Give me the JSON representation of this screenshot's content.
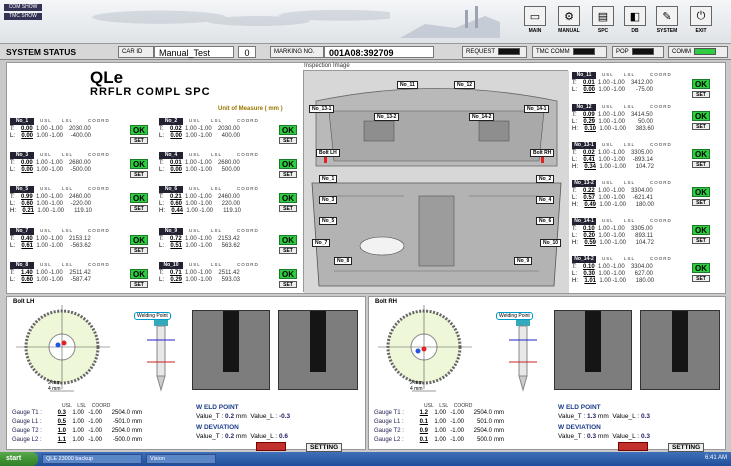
{
  "header": {
    "tag1": "COM SHOW",
    "tag2": "TMC SHOW",
    "nav": [
      {
        "label": "MAIN",
        "icon": "monitor-icon"
      },
      {
        "label": "MANUAL",
        "icon": "gears-icon"
      },
      {
        "label": "SPC",
        "icon": "chart-icon"
      },
      {
        "label": "DB",
        "icon": "database-icon"
      },
      {
        "label": "SYSTEM",
        "icon": "wrench-icon"
      },
      {
        "label": "EXIT",
        "icon": "power-icon"
      }
    ]
  },
  "status": {
    "title": "SYSTEM STATUS",
    "car_id_label": "CAR ID",
    "car_id": "Manual_Test",
    "count": "0",
    "marking_label": "MARKING NO.",
    "marking": "001A08:392709",
    "request": "REQUEST",
    "tmc": "TMC COMM",
    "pop": "POP",
    "comm": "COMM"
  },
  "main": {
    "title": "QLe",
    "subtitle": "RRFLR COMPL SPC",
    "unit": "Unit of Measure ( mm )",
    "image_title": "Inspection Image"
  },
  "cards": [
    {
      "name": "No_1",
      "t": "0.00",
      "l": "0.00",
      "ct": "2030.00",
      "cl": "-400.00",
      "ok": "OK",
      "set": "SET"
    },
    {
      "name": "No_2",
      "t": "0.02",
      "l": "0.00",
      "ct": "2030.00",
      "cl": "400.00",
      "ok": "OK",
      "set": "SET"
    },
    {
      "name": "No_3",
      "t": "0.00",
      "l": "0.00",
      "ct": "2680.00",
      "cl": "-500.00",
      "ok": "OK",
      "set": "SET"
    },
    {
      "name": "No_4",
      "t": "0.01",
      "l": "0.00",
      "ct": "2680.00",
      "cl": "500.00",
      "ok": "OK",
      "set": "SET"
    },
    {
      "name": "No_5",
      "t": "0.99",
      "l": "0.60",
      "h": "0.21",
      "ct": "2460.00",
      "cl": "-220.00",
      "ch": "119.10",
      "ok": "OK",
      "set": "SET"
    },
    {
      "name": "No_6",
      "t": "0.21",
      "l": "0.60",
      "h": "0.44",
      "ct": "2460.00",
      "cl": "220.00",
      "ch": "119.10",
      "ok": "OK",
      "set": "SET"
    },
    {
      "name": "No_7",
      "t": "0.40",
      "l": "0.61",
      "ct": "2153.12",
      "cl": "-563.62",
      "ok": "OK",
      "set": "SET"
    },
    {
      "name": "No_9",
      "t": "0.72",
      "l": "0.51",
      "ct": "2153.42",
      "cl": "563.62",
      "ok": "OK",
      "set": "SET"
    },
    {
      "name": "No_8",
      "t": "1.40",
      "l": "0.60",
      "ct": "2511.42",
      "cl": "-587.47",
      "ok": "OK",
      "set": "SET"
    },
    {
      "name": "No_10",
      "t": "0.71",
      "l": "0.29",
      "ct": "2511.42",
      "cl": "593.03",
      "ok": "OK",
      "set": "SET"
    },
    {
      "name": "No_11",
      "t": "0.01",
      "l": "0.00",
      "ct": "3412.00",
      "cl": "-75.00",
      "ok": "OK",
      "set": "SET"
    },
    {
      "name": "No_12",
      "t": "0.09",
      "l": "0.29",
      "h": "0.10",
      "ct": "3414.50",
      "cl": "50.00",
      "ch": "383.60",
      "ok": "OK",
      "set": "SET"
    },
    {
      "name": "No_13-1",
      "t": "0.02",
      "l": "0.41",
      "h": "0.34",
      "ct": "3305.00",
      "cl": "-893.14",
      "ch": "104.72",
      "ok": "OK",
      "set": "SET"
    },
    {
      "name": "No_13-2",
      "t": "0.22",
      "l": "0.57",
      "h": "0.49",
      "ct": "3304.00",
      "cl": "-621.41",
      "ch": "180.00",
      "ok": "OK",
      "set": "SET"
    },
    {
      "name": "No_14-1",
      "t": "0.10",
      "l": "0.20",
      "h": "0.59",
      "ct": "3305.00",
      "cl": "893.11",
      "ch": "104.72",
      "ok": "OK",
      "set": "SET"
    },
    {
      "name": "No_14-2",
      "t": "0.10",
      "l": "0.30",
      "h": "1.01",
      "ct": "3304.00",
      "cl": "627.00",
      "ch": "180.00",
      "ok": "OK",
      "set": "SET"
    }
  ],
  "card_headers": {
    "usl": "USL",
    "lsl": "LSL",
    "coord": "COORD",
    "usl_v": "1.00",
    "lsl_v": "-1.00"
  },
  "image_labels": [
    "No_11",
    "No_12",
    "No_13-1",
    "No_14-1",
    "No_13-2",
    "No_14-2",
    "Bolt LH",
    "Bolt RH",
    "No_1",
    "No_2",
    "No_3",
    "No_4",
    "No_5",
    "No_6",
    "No_7",
    "No_10",
    "No_8",
    "No_9"
  ],
  "bolt_lh": {
    "title": "Bolt LH",
    "welding_label": "Welding Point",
    "scale": "2 mm",
    "scale2": "4 mm",
    "gauges": [
      {
        "label": "Gauge T1 :",
        "v": "0.3",
        "c": "2504.0"
      },
      {
        "label": "Gauge L1 :",
        "v": "0.5",
        "c": "-501.0"
      },
      {
        "label": "Gauge T2 :",
        "v": "1.0",
        "c": "2504.0"
      },
      {
        "label": "Gauge L2 :",
        "v": "1.1",
        "c": "-500.0"
      }
    ],
    "weld_point": "W ELD POINT",
    "value_t_label": "Value_T :",
    "value_t": "0.2",
    "value_l_label": "Value_L :",
    "value_l": "-0.3",
    "deviation": "W DEVIATION",
    "dev_t": "0.2",
    "dev_l": "0.6",
    "unit": "mm",
    "setting": "SETTING"
  },
  "bolt_rh": {
    "title": "Bolt RH",
    "welding_label": "Welding Point",
    "scale": "2 mm",
    "scale2": "4 mm",
    "gauges": [
      {
        "label": "Gauge T1 :",
        "v": "1.2",
        "c": "2504.0"
      },
      {
        "label": "Gauge L1 :",
        "v": "0.1",
        "c": "501.0"
      },
      {
        "label": "Gauge T2 :",
        "v": "0.9",
        "c": "2504.0"
      },
      {
        "label": "Gauge L2 :",
        "v": "0.1",
        "c": "500.0"
      }
    ],
    "weld_point": "W ELD POINT",
    "value_t_label": "Value_T :",
    "value_t": "1.3",
    "value_l_label": "Value_L :",
    "value_l": "0.3",
    "deviation": "W DEVIATION",
    "dev_t": "0.3",
    "dev_l": "0.3",
    "unit": "mm",
    "setting": "SETTING"
  },
  "gauge_headers": {
    "usl": "USL",
    "lsl": "LSL",
    "coord": "COORD",
    "usl_v": "1.00",
    "lsl_v": "-1.00"
  },
  "taskbar": {
    "start": "start",
    "task1": "QLE 23000 backup",
    "task2": "Vision",
    "clock": "6:41 AM"
  }
}
